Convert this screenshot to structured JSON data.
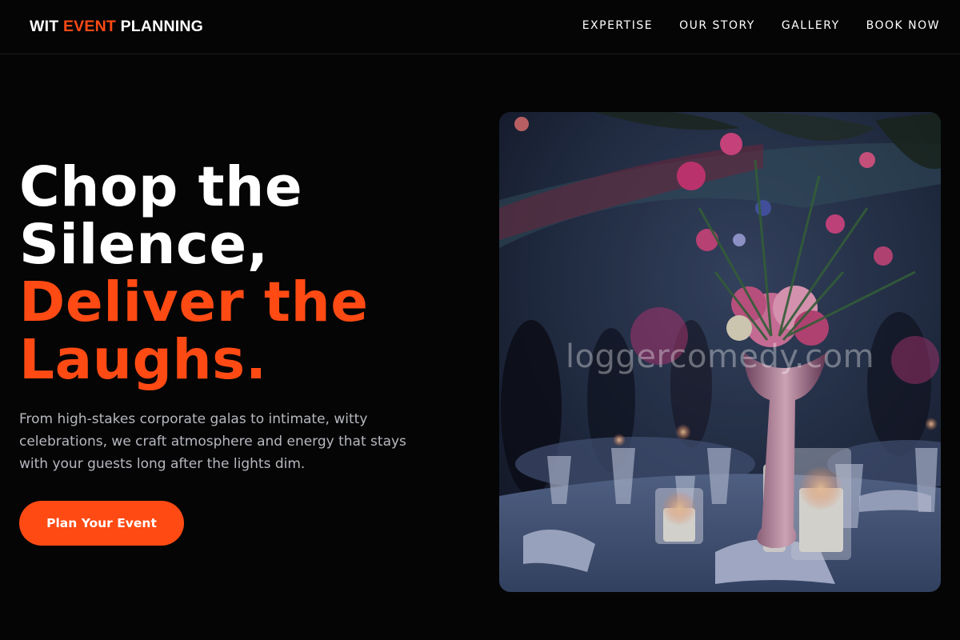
{
  "brand": {
    "part1": "WIT ",
    "part2": "EVENT",
    "part3": " PLANNING",
    "accent_color": "#ff4a14"
  },
  "nav": {
    "items": [
      "EXPERTISE",
      "OUR STORY",
      "GALLERY",
      "BOOK NOW"
    ]
  },
  "hero": {
    "headline_line1": "Chop the",
    "headline_line2": "Silence,",
    "headline_line3": "Deliver the",
    "headline_line4": "Laughs.",
    "description": "From high-stakes corporate galas to intimate, witty celebrations, we craft atmosphere and energy that stays with your guests long after the lights dim.",
    "cta_label": "Plan Your Event"
  },
  "image": {
    "watermark": "loggercomedy.com",
    "subject": "banquet table with floral centerpiece and candles"
  }
}
